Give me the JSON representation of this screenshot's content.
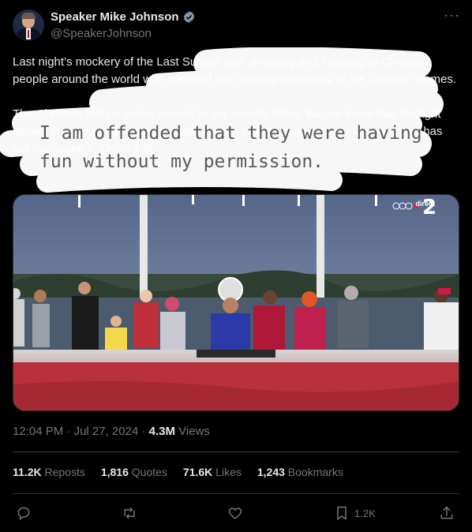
{
  "author": {
    "display_name": "Speaker Mike Johnson",
    "handle": "@SpeakerJohnson"
  },
  "tweet": {
    "paragraphs": [
      "Last night’s mockery of the Last Supper was shocking and insulting to Christian people around the world who watched the opening ceremony of the Olympic Games.",
      "The Christian faith is under assault in our society today. But we know that the light shines in the darkness, and the light shines in the darkness, and the darkness has not overcome it. (John 1:5)"
    ]
  },
  "overlay_caption": {
    "line1": "I am offended that they were having",
    "line2": "fun without my permission."
  },
  "media": {
    "badge_text": "direct"
  },
  "meta": {
    "time": "12:04 PM",
    "separator": "·",
    "date": "Jul 27, 2024",
    "views_count": "4.3M",
    "views_label": "Views"
  },
  "stats": {
    "reposts_count": "11.2K",
    "reposts_label": "Reposts",
    "quotes_count": "1,816",
    "quotes_label": "Quotes",
    "likes_count": "71.6K",
    "likes_label": "Likes",
    "bookmarks_count": "1,243",
    "bookmarks_label": "Bookmarks"
  },
  "actions": {
    "bookmark_count": "1.2K"
  },
  "colors": {
    "background": "#000000",
    "text_primary": "#e7e9ea",
    "text_secondary": "#71767b",
    "divider": "#2f3336",
    "verified": "#829aab"
  }
}
